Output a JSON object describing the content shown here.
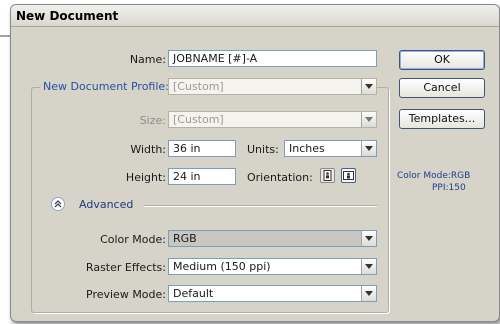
{
  "dialog": {
    "title": "New Document"
  },
  "fields": {
    "name": {
      "label": "Name:",
      "value": "JOBNAME [#]-A"
    },
    "profile": {
      "label": "New Document Profile:",
      "value": "[Custom]"
    },
    "size": {
      "label": "Size:",
      "value": "[Custom]"
    },
    "width": {
      "label": "Width:",
      "value": "36 in"
    },
    "units": {
      "label": "Units:",
      "value": "Inches"
    },
    "height": {
      "label": "Height:",
      "value": "24 in"
    },
    "orientation": {
      "label": "Orientation:",
      "selected": "landscape"
    }
  },
  "advanced": {
    "label": "Advanced",
    "color_mode": {
      "label": "Color Mode:",
      "value": "RGB"
    },
    "raster_effects": {
      "label": "Raster Effects:",
      "value": "Medium (150 ppi)"
    },
    "preview_mode": {
      "label": "Preview Mode:",
      "value": "Default"
    }
  },
  "buttons": {
    "ok": "OK",
    "cancel": "Cancel",
    "templates": "Templates..."
  },
  "info": {
    "color_mode": "Color Mode:RGB",
    "ppi": "PPI:150"
  },
  "colors": {
    "label_blue": "#284f9e",
    "info_blue": "#1f3d8a",
    "titlebar": "#e6e4dc"
  },
  "icons": [
    "dropdown-arrow-icon",
    "portrait-orientation-icon",
    "landscape-orientation-icon",
    "collapse-chevron-icon",
    "arrow-cursor-icon"
  ]
}
